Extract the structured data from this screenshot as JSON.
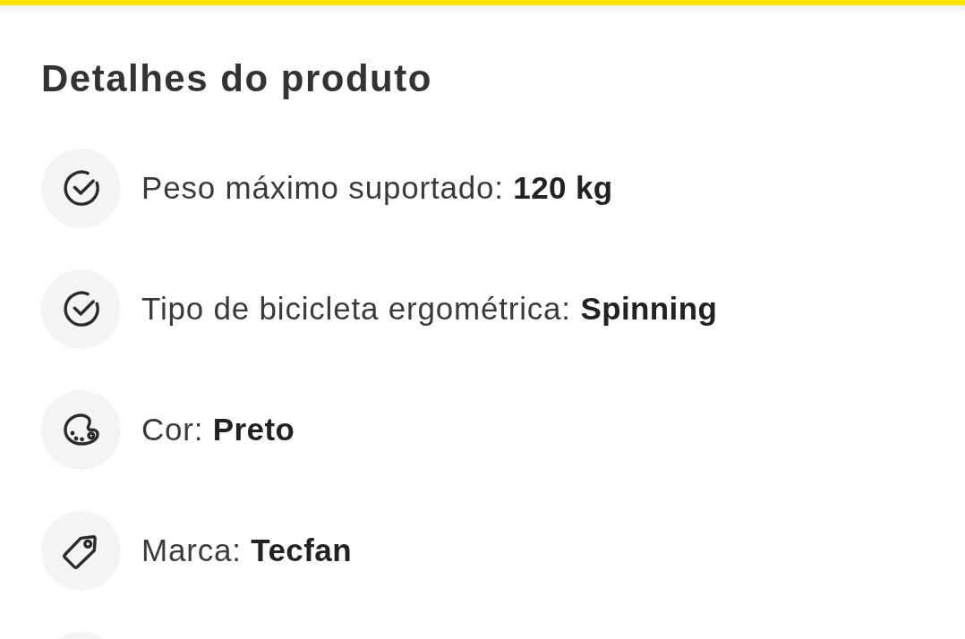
{
  "section": {
    "title": "Detalhes do produto",
    "items": [
      {
        "kind": "check",
        "text": "Peso máximo suportado: **120 kg**"
      },
      {
        "kind": "check",
        "text": "Tipo de bicicleta ergométrica: **Spinning**"
      },
      {
        "kind": "palette",
        "text": "Cor: **Preto**"
      },
      {
        "kind": "tag",
        "text": "Marca: **Tecfan**"
      }
    ]
  }
}
